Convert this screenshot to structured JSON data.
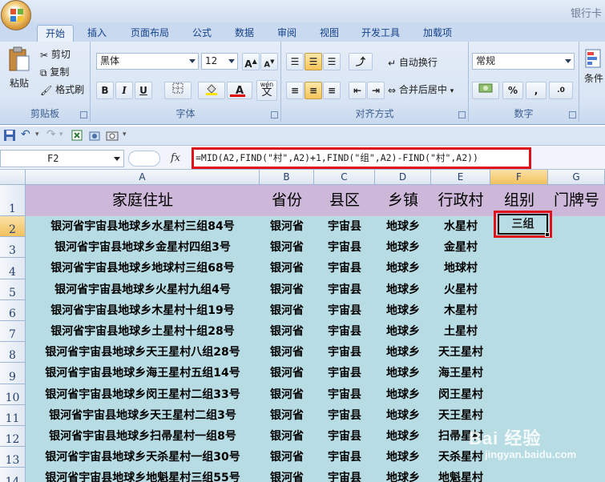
{
  "window": {
    "title": "银行卡"
  },
  "tabs": [
    "开始",
    "插入",
    "页面布局",
    "公式",
    "数据",
    "审阅",
    "视图",
    "开发工具",
    "加载项"
  ],
  "clipboard": {
    "paste": "粘贴",
    "cut": "剪切",
    "copy": "复制",
    "format_painter": "格式刷",
    "label": "剪贴板"
  },
  "font": {
    "name": "黑体",
    "size": "12",
    "label": "字体",
    "bold": "B",
    "italic": "I",
    "underline": "U",
    "phonetic": "wén"
  },
  "alignment": {
    "wrap": "自动换行",
    "merge": "合并后居中",
    "label": "对齐方式"
  },
  "number": {
    "format": "常规",
    "percent": "%",
    "comma": ",",
    "label": "数字"
  },
  "styles": {
    "conditional": "条件"
  },
  "formula_bar": {
    "name_box": "F2",
    "fx": "fx",
    "formula": "=MID(A2,FIND(\"村\",A2)+1,FIND(\"组\",A2)-FIND(\"村\",A2))"
  },
  "sheet": {
    "columns": [
      "A",
      "B",
      "C",
      "D",
      "E",
      "F",
      "G"
    ],
    "header_row": [
      "家庭住址",
      "省份",
      "县区",
      "乡镇",
      "行政村",
      "组别",
      "门牌号"
    ],
    "rows": [
      {
        "n": "2",
        "address": "银河省宇宙县地球乡水星村三组84号",
        "province": "银河省",
        "county": "宇宙县",
        "town": "地球乡",
        "village": "水星村",
        "group": "三组"
      },
      {
        "n": "3",
        "address": "银河省宇宙县地球乡金星村四组3号",
        "province": "银河省",
        "county": "宇宙县",
        "town": "地球乡",
        "village": "金星村",
        "group": ""
      },
      {
        "n": "4",
        "address": "银河省宇宙县地球乡地球村三组68号",
        "province": "银河省",
        "county": "宇宙县",
        "town": "地球乡",
        "village": "地球村",
        "group": ""
      },
      {
        "n": "5",
        "address": "银河省宇宙县地球乡火星村九组4号",
        "province": "银河省",
        "county": "宇宙县",
        "town": "地球乡",
        "village": "火星村",
        "group": ""
      },
      {
        "n": "6",
        "address": "银河省宇宙县地球乡木星村十组19号",
        "province": "银河省",
        "county": "宇宙县",
        "town": "地球乡",
        "village": "木星村",
        "group": ""
      },
      {
        "n": "7",
        "address": "银河省宇宙县地球乡土星村十组28号",
        "province": "银河省",
        "county": "宇宙县",
        "town": "地球乡",
        "village": "土星村",
        "group": ""
      },
      {
        "n": "8",
        "address": "银河省宇宙县地球乡天王星村八组28号",
        "province": "银河省",
        "county": "宇宙县",
        "town": "地球乡",
        "village": "天王星村",
        "group": ""
      },
      {
        "n": "9",
        "address": "银河省宇宙县地球乡海王星村五组14号",
        "province": "银河省",
        "county": "宇宙县",
        "town": "地球乡",
        "village": "海王星村",
        "group": ""
      },
      {
        "n": "10",
        "address": "银河省宇宙县地球乡闵王星村二组33号",
        "province": "银河省",
        "county": "宇宙县",
        "town": "地球乡",
        "village": "闵王星村",
        "group": ""
      },
      {
        "n": "11",
        "address": "银河省宇宙县地球乡天王星村二组3号",
        "province": "银河省",
        "county": "宇宙县",
        "town": "地球乡",
        "village": "天王星村",
        "group": ""
      },
      {
        "n": "12",
        "address": "银河省宇宙县地球乡扫帚星村一组8号",
        "province": "银河省",
        "county": "宇宙县",
        "town": "地球乡",
        "village": "扫帚星村",
        "group": ""
      },
      {
        "n": "13",
        "address": "银河省宇宙县地球乡天杀星村一组30号",
        "province": "银河省",
        "county": "宇宙县",
        "town": "地球乡",
        "village": "天杀星村",
        "group": ""
      },
      {
        "n": "14",
        "address": "银河省宇宙县地球乡地魁星村三组55号",
        "province": "银河省",
        "county": "宇宙县",
        "town": "地球乡",
        "village": "地魁星村",
        "group": ""
      }
    ]
  },
  "watermark": {
    "brand": "Bai 经验",
    "url": "jingyan.baidu.com"
  },
  "colors": {
    "header_row_bg": "#cdb8d9",
    "data_bg": "#b8dce3",
    "highlight_border": "#e0111a"
  }
}
